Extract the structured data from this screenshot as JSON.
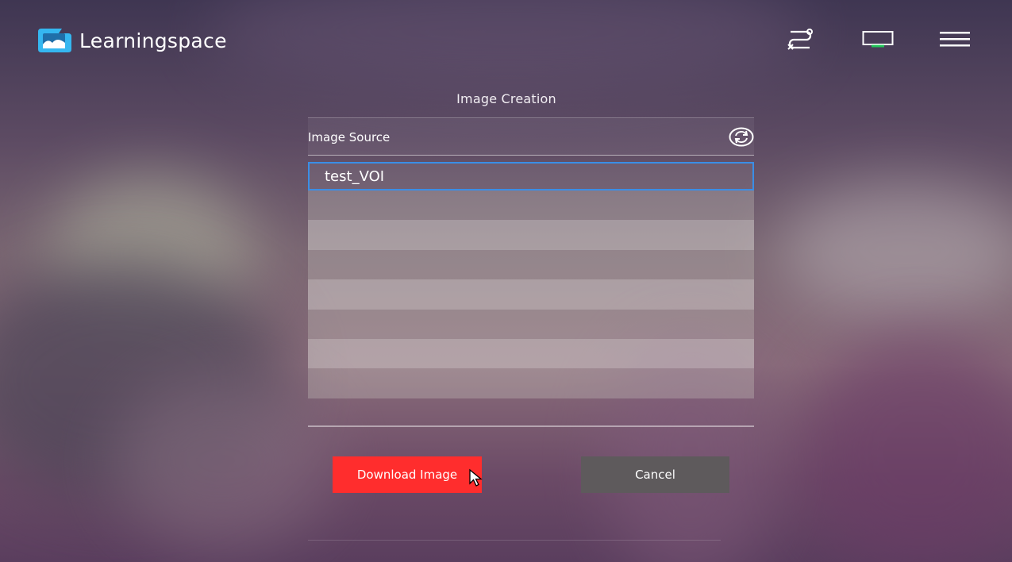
{
  "app": {
    "name": "Learningspace"
  },
  "topbar": {
    "icons": [
      "route-icon",
      "screen-icon",
      "hamburger-menu-icon"
    ],
    "screen_indicator_color": "#23c45a"
  },
  "dialog": {
    "title": "Image Creation",
    "source_label": "Image Source",
    "items": [
      "test_VOI",
      "",
      "",
      "",
      "",
      "",
      "",
      ""
    ],
    "selected_index": 0,
    "buttons": {
      "download": "Download Image",
      "cancel": "Cancel"
    }
  },
  "colors": {
    "accent": "#ff2d2d",
    "selection_border": "#3a8ee6",
    "logo": "#35b7f0",
    "cancel": "#5e5a5c"
  }
}
